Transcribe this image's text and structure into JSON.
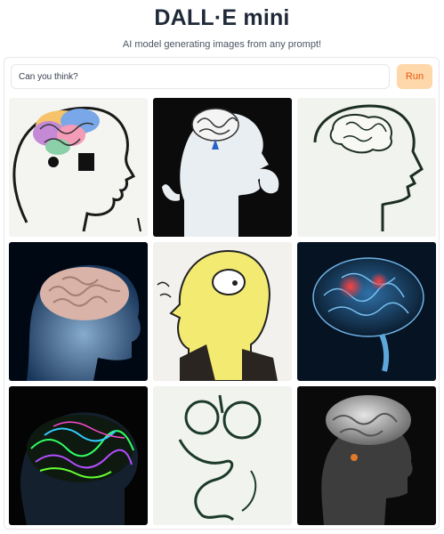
{
  "header": {
    "title": "DALL·E mini",
    "subtitle": "AI model generating images from any prompt!"
  },
  "prompt": {
    "value": "Can you think?"
  },
  "run_button": {
    "label": "Run"
  },
  "colors": {
    "accent_bg": "#fed7aa",
    "accent_text": "#ea580c"
  },
  "gallery": {
    "images": [
      "colorful-brain-head-outline",
      "silhouette-head-brain",
      "brain-sketch-profile",
      "pink-brain-blue-head",
      "yellow-head-cartoon",
      "transparent-blue-brain-red-glow",
      "neon-green-brain-head",
      "scribble-face-sketch",
      "gray-brain-head-dark"
    ]
  }
}
